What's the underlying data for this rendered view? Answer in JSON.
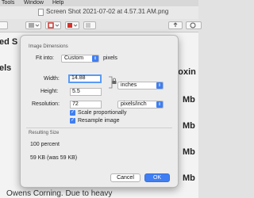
{
  "menubar": {
    "items": [
      "Tools",
      "Window",
      "Help"
    ]
  },
  "window": {
    "title": "Screen Shot 2021-07-02 at 4.57.31 AM.png"
  },
  "background": {
    "fragments": [
      "ed S",
      "els",
      "Mb",
      "Mb",
      "Mb",
      "Mb",
      "roxin",
      "Owens Corning. Due to heavy"
    ]
  },
  "dialog": {
    "section_image": "Image Dimensions",
    "fit_into_label": "Fit into:",
    "fit_into_value": "Custom",
    "fit_into_unit": "pixels",
    "width_label": "Width:",
    "width_value": "14.88",
    "height_label": "Height:",
    "height_value": "5.5",
    "size_unit": "inches",
    "resolution_label": "Resolution:",
    "resolution_value": "72",
    "resolution_unit": "pixels/inch",
    "scale_label": "Scale proportionally",
    "resample_label": "Resample image",
    "section_result": "Resulting Size",
    "percent": "100 percent",
    "size": "59 KB (was 59 KB)",
    "cancel_label": "Cancel",
    "ok_label": "OK"
  },
  "colors": {
    "accent": "#3f7ef2",
    "swatch_red": "#d0342c"
  },
  "icons": [
    "document-icon",
    "sidebar-toggle-icon",
    "share-icon",
    "markup-icon",
    "lock-icon",
    "checkmark-icon",
    "chevron-updown-icon"
  ]
}
